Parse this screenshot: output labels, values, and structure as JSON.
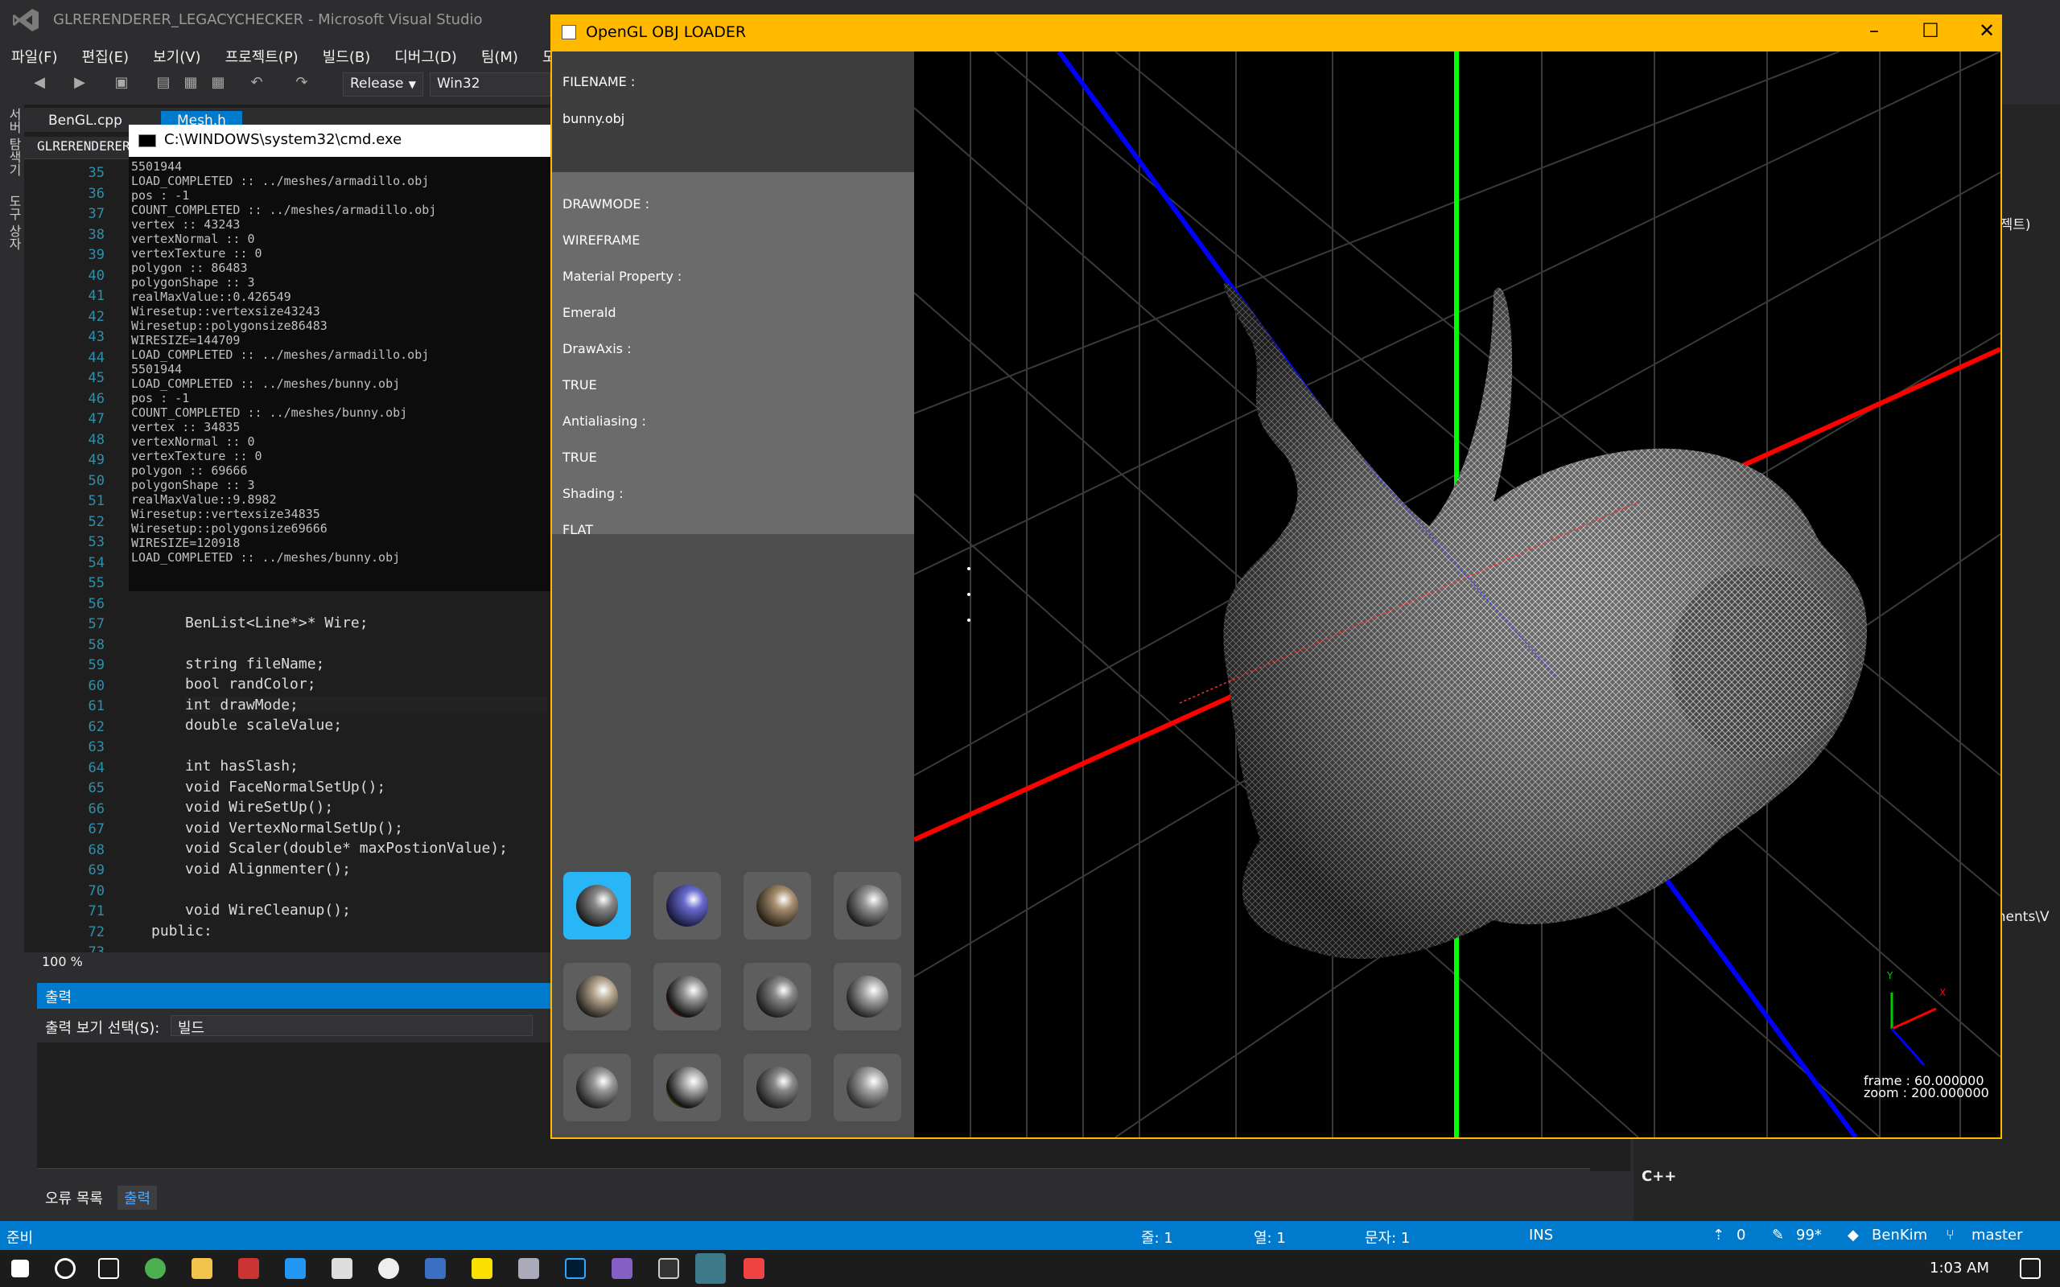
{
  "vs": {
    "title": "GLRERENDERER_LEGACYCHECKER - Microsoft Visual Studio",
    "menu": [
      "파일(F)",
      "편집(E)",
      "보기(V)",
      "프로젝트(P)",
      "빌드(B)",
      "디버그(D)",
      "팀(M)",
      "도"
    ],
    "toolbar": {
      "config": "Release",
      "platform": "Win32"
    },
    "left_strip": [
      "서버 탐색기",
      "도구 상자"
    ],
    "tabs": [
      "BenGL.cpp",
      "Mesh.h"
    ],
    "nav_project": "GLRERENDERER_LEGACYCHECKER",
    "zoom": "100 %",
    "output_title": "출력",
    "output_select_label": "출력 보기 선택(S):",
    "output_select_value": "빌드",
    "bottom_tabs": [
      "오류 목록",
      "출력"
    ],
    "right_labels": {
      "proj": "로젝트)",
      "docs": "ments\\V",
      "lang": "C++"
    },
    "status": {
      "ready": "준비",
      "line": "줄: 1",
      "col": "열: 1",
      "char": "문자: 1",
      "mode": "INS",
      "up": "0",
      "pen": "99*",
      "user": "BenKim",
      "branch": "master"
    },
    "taskbar_time": "1:03 AM"
  },
  "cmd": {
    "title": "C:\\WINDOWS\\system32\\cmd.exe",
    "lines": [
      "5501944",
      "LOAD_COMPLETED :: ../meshes/armadillo.obj",
      "pos : -1",
      "COUNT_COMPLETED :: ../meshes/armadillo.obj",
      "vertex :: 43243",
      "vertexNormal :: 0",
      "vertexTexture :: 0",
      "polygon :: 86483",
      "polygonShape :: 3",
      "realMaxValue::0.426549",
      "Wiresetup::vertexsize43243",
      "Wiresetup::polygonsize86483",
      "WIRESIZE=144709",
      "LOAD_COMPLETED :: ../meshes/armadillo.obj",
      "5501944",
      "LOAD_COMPLETED :: ../meshes/bunny.obj",
      "pos : -1",
      "COUNT_COMPLETED :: ../meshes/bunny.obj",
      "vertex :: 34835",
      "vertexNormal :: 0",
      "vertexTexture :: 0",
      "polygon :: 69666",
      "polygonShape :: 3",
      "realMaxValue::9.8982",
      "Wiresetup::vertexsize34835",
      "Wiresetup::polygonsize69666",
      "WIRESIZE=120918",
      "LOAD_COMPLETED :: ../meshes/bunny.obj"
    ]
  },
  "editor": {
    "line_numbers": [
      "35",
      "36",
      "37",
      "38",
      "39",
      "40",
      "41",
      "42",
      "43",
      "44",
      "45",
      "46",
      "47",
      "48",
      "49",
      "50",
      "51",
      "52",
      "53",
      "54",
      "55",
      "56",
      "57",
      "58",
      "59",
      "60",
      "61",
      "62",
      "63",
      "64",
      "65",
      "66",
      "67",
      "68",
      "69",
      "70",
      "71",
      "72",
      "73"
    ],
    "code": [
      "BenList<Line*>* Wire;",
      "",
      "string fileName;",
      "bool randColor;",
      "int drawMode;",
      "double scaleValue;",
      "",
      "int hasSlash;",
      "void FaceNormalSetUp();",
      "void WireSetUp();",
      "void VertexNormalSetUp();",
      "void Scaler(double* maxPostionValue);",
      "void Alignmenter();",
      "",
      "void WireCleanup();",
      "public:"
    ]
  },
  "gl": {
    "title": "OpenGL OBJ LOADER",
    "filename_label": "FILENAME :",
    "filename_value": "bunny.obj",
    "props": [
      {
        "label": "DRAWMODE :",
        "value": "WIREFRAME"
      },
      {
        "label": "Material Property :",
        "value": "Emerald"
      },
      {
        "label": "DrawAxis :",
        "value": "TRUE"
      },
      {
        "label": "Antialiasing :",
        "value": "TRUE"
      },
      {
        "label": "Shading :",
        "value": "FLAT"
      }
    ],
    "frame": "frame : 60.000000",
    "zoom": "zoom : 200.000000",
    "axis_labels": {
      "y": "Y",
      "x": "X"
    }
  }
}
